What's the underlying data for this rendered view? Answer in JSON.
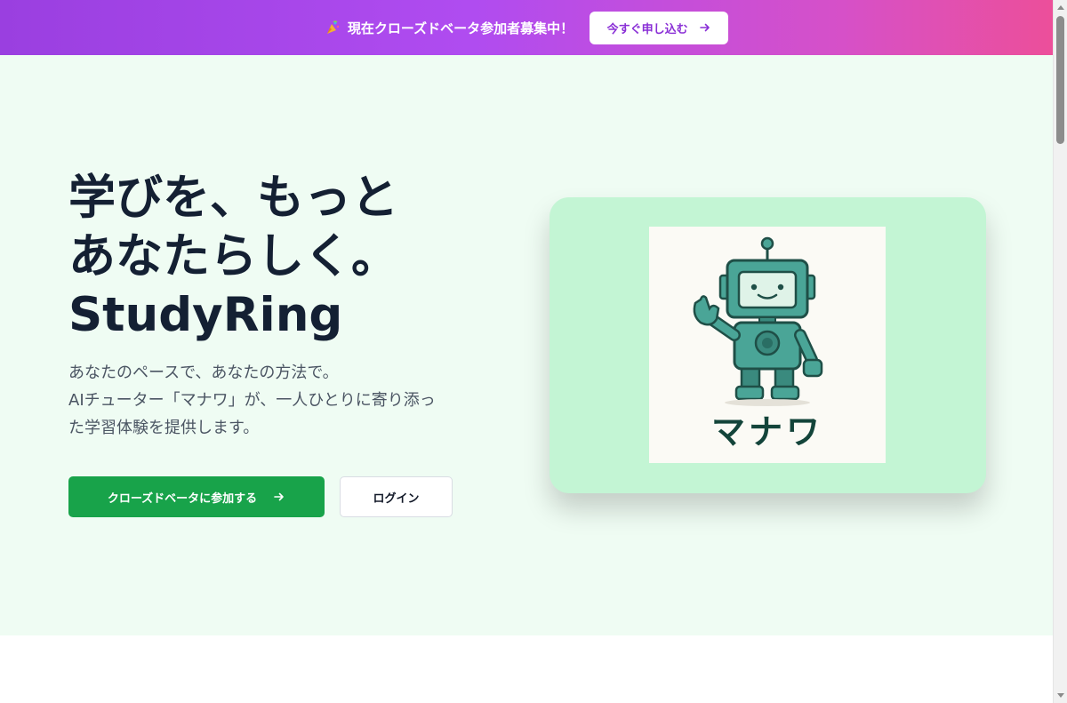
{
  "banner": {
    "text": "現在クローズドベータ参加者募集中！",
    "icon": "party-popper-icon",
    "cta_label": "今すぐ申し込む"
  },
  "hero": {
    "headline_lines": [
      "学びを、もっと",
      "あなたらしく。",
      "StudyRing"
    ],
    "subtext_lines": [
      "あなたのペースで、あなたの方法で。",
      "AIチューター「マナワ」が、一人ひとりに寄り添っ",
      "た学習体験を提供します。"
    ],
    "primary_button": "クローズドベータに参加する",
    "secondary_button": "ログイン"
  },
  "mascot": {
    "name": "マナワ"
  },
  "colors": {
    "banner_gradient": [
      "#9a3fe0",
      "#ec4f9a"
    ],
    "primary": "#18a34a",
    "hero_bg": "#effcf3",
    "card_bg": "#c3f5d4",
    "robot": "#4aa597"
  }
}
